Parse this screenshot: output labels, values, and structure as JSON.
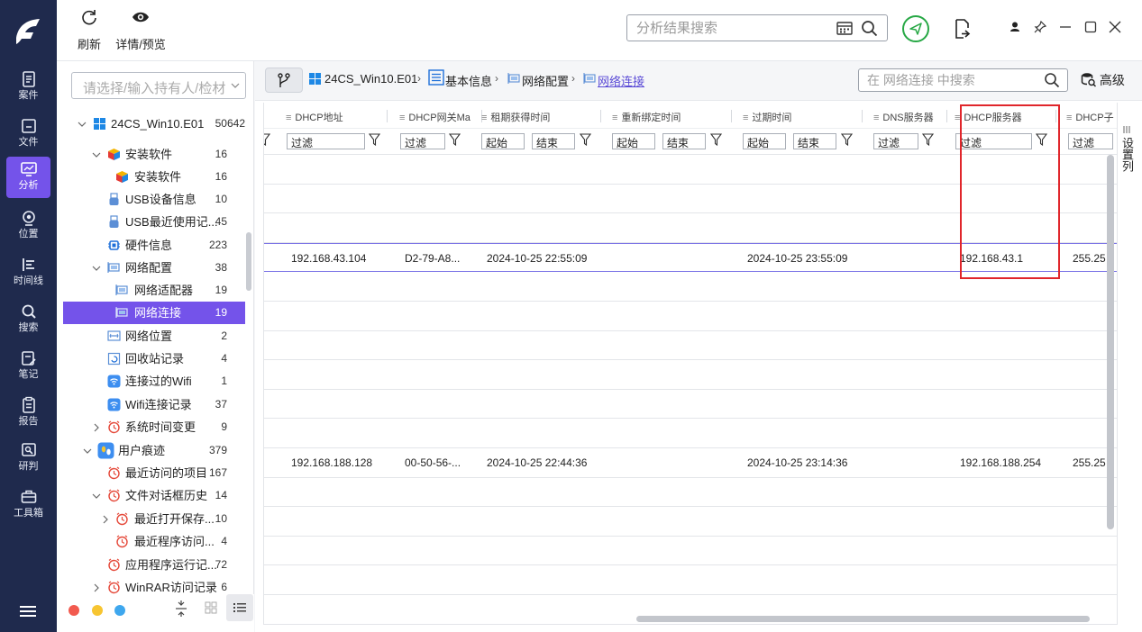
{
  "rail": {
    "items": [
      {
        "label": "案件",
        "icon": "document-icon"
      },
      {
        "label": "文件",
        "icon": "file-icon"
      },
      {
        "label": "分析",
        "icon": "analysis-icon",
        "active": true
      },
      {
        "label": "位置",
        "icon": "location-icon"
      },
      {
        "label": "时间线",
        "icon": "timeline-icon"
      },
      {
        "label": "搜索",
        "icon": "search-icon"
      },
      {
        "label": "笔记",
        "icon": "note-icon"
      },
      {
        "label": "报告",
        "icon": "report-icon"
      },
      {
        "label": "研判",
        "icon": "judge-icon"
      },
      {
        "label": "工具箱",
        "icon": "toolbox-icon"
      }
    ]
  },
  "toolbar": {
    "refresh_label": "刷新",
    "preview_label": "详情/预览",
    "search_placeholder": "分析结果搜索"
  },
  "tree": {
    "filter_placeholder": "请选择/输入持有人/检材",
    "items": [
      {
        "label": "24CS_Win10.E01",
        "count": "50642"
      },
      {
        "label": "安装软件",
        "count": "16"
      },
      {
        "label": "安装软件",
        "count": "16"
      },
      {
        "label": "USB设备信息",
        "count": "10"
      },
      {
        "label": "USB最近使用记...",
        "count": "45"
      },
      {
        "label": "硬件信息",
        "count": "223"
      },
      {
        "label": "网络配置",
        "count": "38"
      },
      {
        "label": "网络适配器",
        "count": "19"
      },
      {
        "label": "网络连接",
        "count": "19"
      },
      {
        "label": "网络位置",
        "count": "2"
      },
      {
        "label": "回收站记录",
        "count": "4"
      },
      {
        "label": "连接过的Wifi",
        "count": "1"
      },
      {
        "label": "Wifi连接记录",
        "count": "37"
      },
      {
        "label": "系统时间变更",
        "count": "9"
      },
      {
        "label": "用户痕迹",
        "count": "379"
      },
      {
        "label": "最近访问的项目",
        "count": "167"
      },
      {
        "label": "文件对话框历史",
        "count": "14"
      },
      {
        "label": "最近打开保存...",
        "count": "10"
      },
      {
        "label": "最近程序访问...",
        "count": "4"
      },
      {
        "label": "应用程序运行记...",
        "count": "72"
      },
      {
        "label": "WinRAR访问记录",
        "count": "6"
      }
    ]
  },
  "breadcrumb": {
    "evidence": "24CS_Win10.E01",
    "basic": "基本信息",
    "netconf": "网络配置",
    "current": "网络连接"
  },
  "inner_search_placeholder": "在 网络连接 中搜索",
  "advanced_label": "高级",
  "column_settings_label": "设置列",
  "table": {
    "columns": [
      "DHCP地址",
      "DHCP网关Ma",
      "租期获得时间",
      "重新绑定时间",
      "过期时间",
      "DNS服务器",
      "DHCP服务器",
      "DHCP子"
    ],
    "filter_label": "过滤",
    "start_label": "起始",
    "end_label": "结束",
    "rows": [
      {
        "dhcp_addr": "192.168.43.104",
        "gateway_mac": "D2-79-A8...",
        "lease_obtained": "2024-10-25 22:55:09",
        "expires": "2024-10-25 23:55:09",
        "dhcp_server": "192.168.43.1",
        "subnet": "255.25"
      },
      {
        "dhcp_addr": "192.168.188.128",
        "gateway_mac": "00-50-56-...",
        "lease_obtained": "2024-10-25 22:44:36",
        "expires": "2024-10-25 23:14:36",
        "dhcp_server": "192.168.188.254",
        "subnet": "255.25"
      }
    ]
  },
  "colors": {
    "accent": "#7453ea",
    "rail_bg": "#1f2a4d",
    "highlight_box": "#e0262b"
  }
}
